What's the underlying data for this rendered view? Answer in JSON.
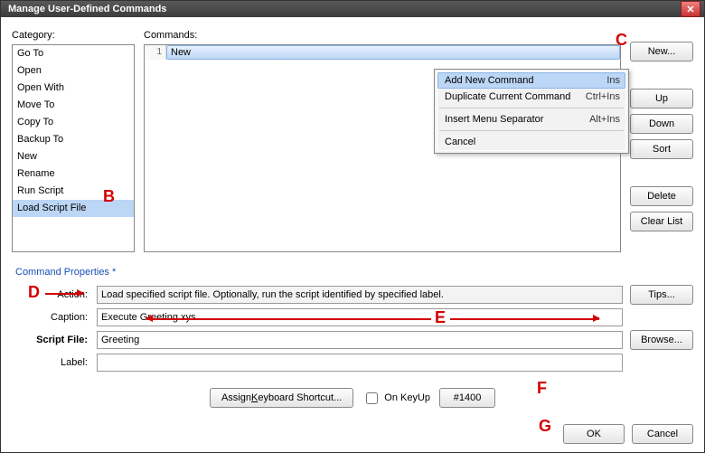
{
  "window": {
    "title": "Manage User-Defined Commands"
  },
  "labels": {
    "category": "Category:",
    "commands": "Commands:",
    "properties_heading": "Command Properties *",
    "action": "Action:",
    "caption": "Caption:",
    "script_file": "Script File:",
    "label": "Label:",
    "on_keyup": "On KeyUp"
  },
  "categories": [
    "Go To",
    "Open",
    "Open With",
    "Move To",
    "Copy To",
    "Backup To",
    "New",
    "Rename",
    "Run Script",
    "Load Script File"
  ],
  "selected_category_index": 9,
  "commands_list": {
    "rows": [
      {
        "index": "1",
        "text": "New"
      }
    ],
    "selected_index": 0
  },
  "side_buttons": {
    "new": "New...",
    "up": "Up",
    "down": "Down",
    "sort": "Sort",
    "delete": "Delete",
    "clear_list": "Clear List"
  },
  "fields": {
    "action_text": "Load specified script file. Optionally, run the script identified by specified label.",
    "caption_value": "Execute Greeting.xys",
    "script_file_value": "Greeting",
    "label_value": ""
  },
  "buttons": {
    "tips": "Tips...",
    "browse": "Browse...",
    "assign": "Assign Keyboard Shortcut...",
    "id_btn": "#1400",
    "ok": "OK",
    "cancel": "Cancel"
  },
  "context_menu": {
    "items": [
      {
        "label": "Add New Command",
        "accel": "Ins",
        "selected": true
      },
      {
        "label": "Duplicate Current Command",
        "accel": "Ctrl+Ins"
      },
      {
        "sep": true
      },
      {
        "label": "Insert Menu Separator",
        "accel": "Alt+Ins"
      },
      {
        "sep": true
      },
      {
        "label": "Cancel",
        "accel": ""
      }
    ]
  },
  "annotations": {
    "B": "B",
    "C": "C",
    "D": "D",
    "E": "E",
    "F": "F",
    "G": "G"
  }
}
